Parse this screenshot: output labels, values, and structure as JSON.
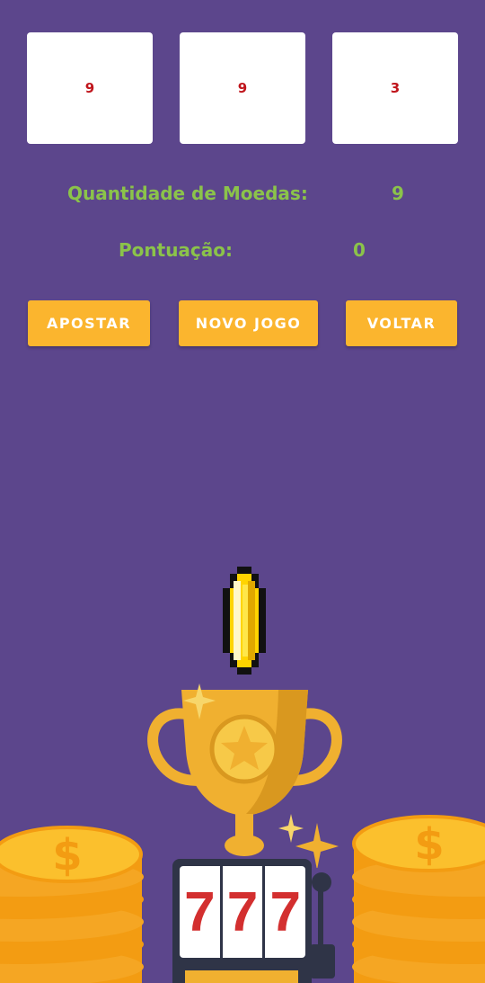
{
  "reels": [
    "9",
    "9",
    "3"
  ],
  "stats": {
    "coins_label": "Quantidade de Moedas:",
    "coins_value": "9",
    "score_label": "Pontuação:",
    "score_value": "0"
  },
  "buttons": {
    "bet": "APOSTAR",
    "new_game": "NOVO JOGO",
    "back": "VOLTAR"
  },
  "machine": {
    "digits": [
      "7",
      "7",
      "7"
    ]
  },
  "colors": {
    "background": "#5c468c",
    "button": "#fbb52e",
    "label_text": "#8bc34a",
    "reel_digit": "#c0151c"
  }
}
